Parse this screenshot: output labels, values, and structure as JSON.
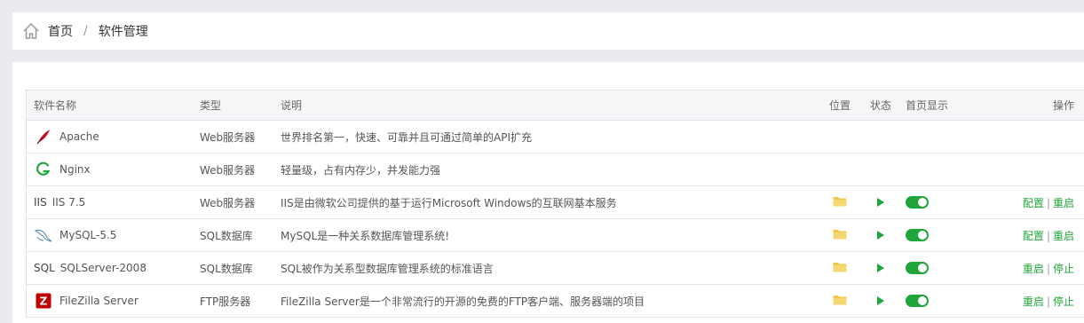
{
  "breadcrumb": {
    "home": "首页",
    "sep": "/",
    "current": "软件管理"
  },
  "table": {
    "headers": {
      "name": "软件名称",
      "type": "类型",
      "desc": "说明",
      "pos": "位置",
      "status": "状态",
      "home": "首页显示",
      "op": "操作"
    },
    "rows": [
      {
        "icon": "apache-feather-icon",
        "name": "Apache",
        "type": "Web服务器",
        "desc": "世界排名第一，快速、可靠并且可通过简单的API扩充",
        "installed": false
      },
      {
        "icon": "nginx-logo-icon",
        "name": "Nginx",
        "type": "Web服务器",
        "desc": "轻量级，占有内存少，并发能力强",
        "installed": false
      },
      {
        "icon": "iis-icon",
        "icon_text": "IIS",
        "name": "IIS 7.5",
        "type": "Web服务器",
        "desc": "IIS是由微软公司提供的基于运行Microsoft Windows的互联网基本服务",
        "installed": true,
        "op1": "配置",
        "op2": "重启"
      },
      {
        "icon": "mysql-dolphin-icon",
        "name": "MySQL-5.5",
        "type": "SQL数据库",
        "desc": "MySQL是一种关系数据库管理系统!",
        "installed": true,
        "op1": "配置",
        "op2": "重启"
      },
      {
        "icon": "sql-icon",
        "icon_text": "SQL",
        "name": "SQLServer-2008",
        "type": "SQL数据库",
        "desc": "SQL被作为关系型数据库管理系统的标准语言",
        "installed": true,
        "op1": "重启",
        "op2": "停止"
      },
      {
        "icon": "filezilla-icon",
        "name": "FileZilla Server",
        "type": "FTP服务器",
        "desc": "FileZilla Server是一个非常流行的开源的免费的FTP客户端、服务器端的项目",
        "installed": true,
        "op1": "重启",
        "op2": "停止"
      }
    ],
    "op_sep": "|"
  },
  "colors": {
    "accent": "#20a53a",
    "folder": "#f0c94a",
    "apache": "#c8102e",
    "nginx": "#20a53a",
    "filezilla": "#bf0000"
  }
}
